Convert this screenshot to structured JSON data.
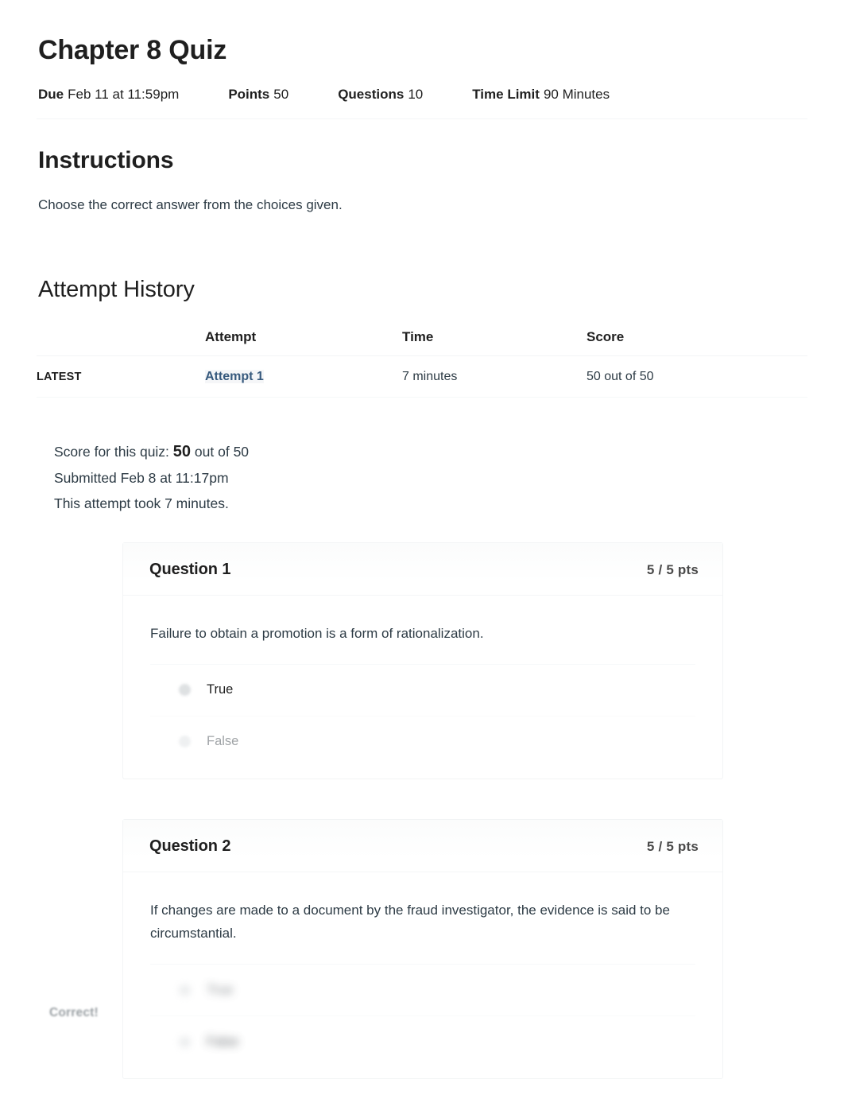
{
  "quiz": {
    "title": "Chapter 8 Quiz",
    "meta": [
      {
        "label": "Due",
        "value": "Feb 11 at 11:59pm"
      },
      {
        "label": "Points",
        "value": "50"
      },
      {
        "label": "Questions",
        "value": "10"
      },
      {
        "label": "Time Limit",
        "value": "90 Minutes"
      }
    ]
  },
  "instructions": {
    "heading": "Instructions",
    "body": "Choose the correct answer from the choices given."
  },
  "attempt_history": {
    "heading": "Attempt History",
    "columns": [
      "",
      "Attempt",
      "Time",
      "Score"
    ],
    "rows": [
      {
        "flag": "LATEST",
        "attempt": "Attempt 1",
        "time": "7 minutes",
        "score": "50 out of 50"
      }
    ]
  },
  "score_summary": {
    "score_prefix": "Score for this quiz:",
    "score_value": "50",
    "score_suffix": "out of 50",
    "submitted": "Submitted Feb 8 at 11:17pm",
    "duration": "This attempt took 7 minutes."
  },
  "questions": [
    {
      "name": "Question 1",
      "points": "5 / 5 pts",
      "text": "Failure to obtain a promotion is a form of rationalization.",
      "answers": [
        {
          "label": "True",
          "state": "selected"
        },
        {
          "label": "False",
          "state": "dim"
        }
      ]
    },
    {
      "name": "Question 2",
      "points": "5 / 5 pts",
      "text": "If changes are made to a document by the fraud investigator, the evidence is said to be circumstantial.",
      "answers": [
        {
          "label": "True",
          "state": "blurred"
        },
        {
          "label": "False",
          "state": "blurred-strong"
        }
      ]
    }
  ],
  "feedback": {
    "correct_flag": "Correct!"
  },
  "colors": {
    "link": "#36597d",
    "text": "#2d3b45",
    "heading": "#1f1f1f",
    "muted": "#a0a4a7"
  }
}
